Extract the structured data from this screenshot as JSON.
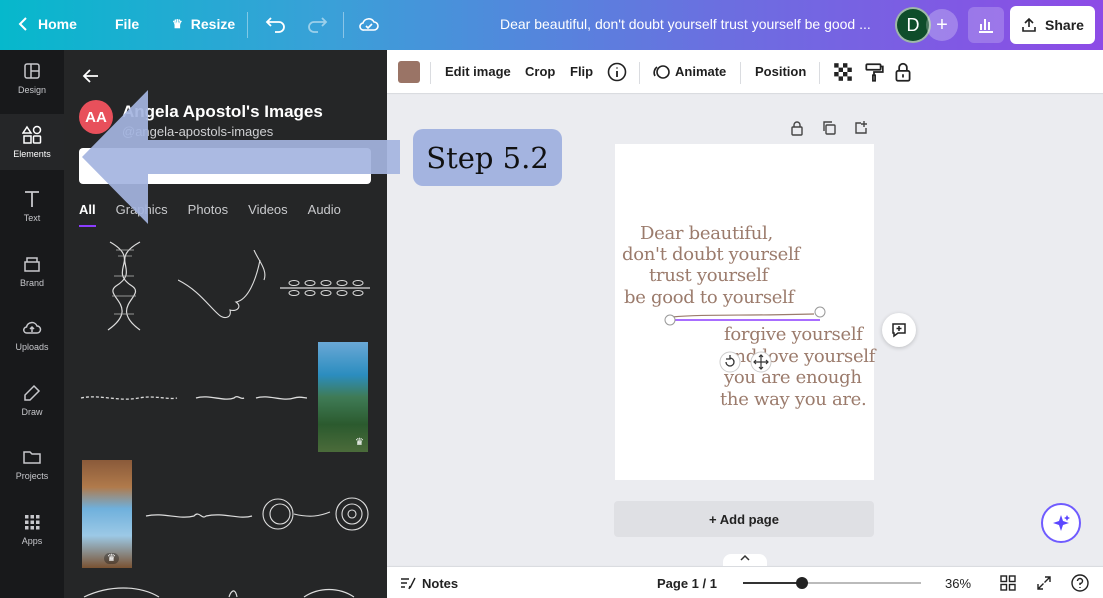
{
  "topbar": {
    "home_label": "Home",
    "file_label": "File",
    "resize_label": "Resize",
    "doc_title": "Dear beautiful, don't doubt yourself trust yourself be good ...",
    "avatar_letter": "D",
    "share_label": "Share"
  },
  "rail": {
    "items": [
      {
        "label": "Design",
        "icon": "layout-icon"
      },
      {
        "label": "Elements",
        "icon": "shapes-icon",
        "active": true
      },
      {
        "label": "Text",
        "icon": "text-icon"
      },
      {
        "label": "Brand",
        "icon": "brand-icon"
      },
      {
        "label": "Uploads",
        "icon": "upload-cloud-icon"
      },
      {
        "label": "Draw",
        "icon": "pen-icon"
      },
      {
        "label": "Projects",
        "icon": "folder-icon"
      },
      {
        "label": "Apps",
        "icon": "grid-icon"
      }
    ]
  },
  "panel": {
    "avatar_initials": "AA",
    "title": "Angela Apostol's Images",
    "subtitle": "@angela-apostols-images",
    "search_value": "",
    "tabs": [
      "All",
      "Graphics",
      "Photos",
      "Videos",
      "Audio"
    ]
  },
  "editbar": {
    "swatch_color": "#9a7466",
    "edit_image": "Edit image",
    "crop": "Crop",
    "flip": "Flip",
    "animate": "Animate",
    "position": "Position"
  },
  "design": {
    "quote_top": [
      "Dear beautiful,",
      "don't doubt yourself",
      "trust yourself",
      "be good to yourself"
    ],
    "quote_bottom": [
      "forgive yourself",
      "and love yourself",
      "you are enough",
      "the way you are."
    ],
    "text_color": "#9b7b6c"
  },
  "add_page_label": "+ Add page",
  "bottombar": {
    "notes_label": "Notes",
    "page_indicator": "Page 1 / 1",
    "zoom": "36%",
    "zoom_fraction": 0.33
  },
  "annotation": {
    "step_label": "Step 5.2",
    "arrow_color": "#a4b4e0"
  }
}
